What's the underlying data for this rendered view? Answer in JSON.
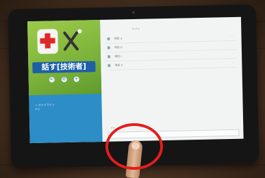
{
  "app": {
    "badge_text": "話す[技術者]",
    "left_caption_line1": "ー ガイドライン",
    "left_caption_line2": "ナビ"
  },
  "list": {
    "header": "アプリ",
    "rows": [
      {
        "name": "項目 a",
        "meta": "---"
      },
      {
        "name": "項目 b",
        "meta": "---"
      },
      {
        "name": "項目 c",
        "meta": "---"
      },
      {
        "name": "項目 d",
        "meta": "---"
      }
    ]
  },
  "bottom": {
    "label": "メモ"
  },
  "colors": {
    "highlight": "#e31d1d",
    "left_top": "#7bb23a",
    "left_bottom": "#2c8dc7",
    "badge": "#1e5fa8"
  }
}
